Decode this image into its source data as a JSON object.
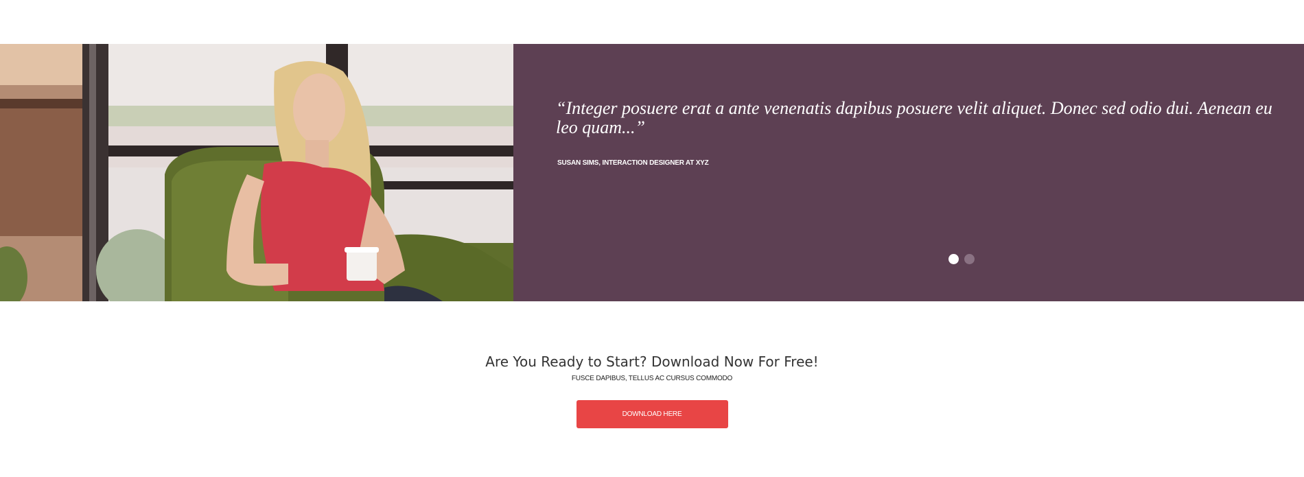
{
  "testimonial": {
    "quote": "“Integer posuere erat a ante venenatis dapibus posuere velit aliquet. Donec sed odio dui. Aenean eu leo quam...”",
    "author": "SUSAN SIMS, INTERACTION DESIGNER AT XYZ",
    "slides": {
      "total": 2,
      "active": 1
    },
    "photo": "woman-in-red-top-holding-coffee-cup-in-armchair"
  },
  "cta": {
    "title": "Are You Ready to Start? Download Now For Free!",
    "subtitle": "FUSCE DAPIBUS, TELLUS AC CURSUS COMMODO",
    "button_label": "DOWNLOAD HERE"
  },
  "colors": {
    "quote_panel_bg": "#5d4053",
    "button_bg": "#e84545",
    "dot_active": "#ffffff",
    "dot_inactive": "#8a7283"
  }
}
